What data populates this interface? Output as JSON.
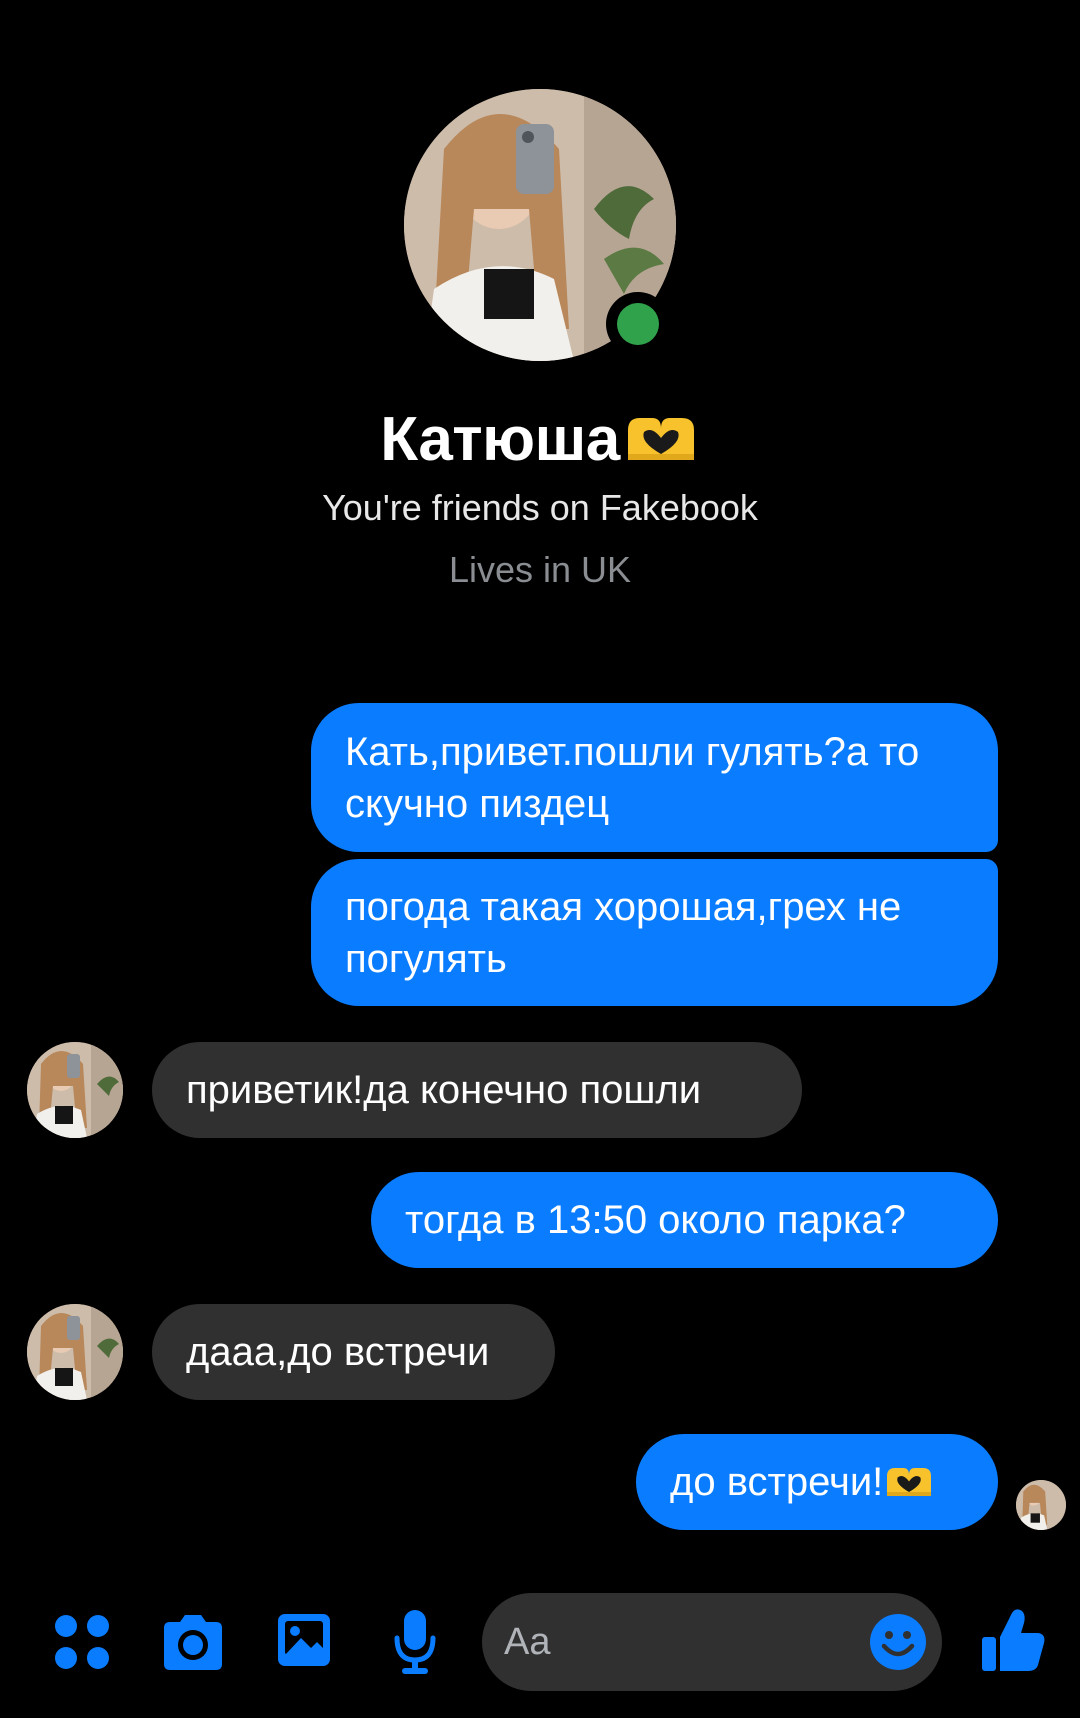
{
  "profile": {
    "name": "Катюша",
    "name_emoji_icon": "heart-hands-icon",
    "friends_text": "You're friends on Fakebook",
    "location_text": "Lives in UK",
    "online": true
  },
  "messages": [
    {
      "from": "me",
      "text": "Кать,привет.пошли гулять?а то скучно пиздец"
    },
    {
      "from": "me",
      "text": "погода такая хорошая,грех не погулять"
    },
    {
      "from": "them",
      "text": "приветик!да конечно пошли"
    },
    {
      "from": "me",
      "text": "тогда в 13:50 около парка?"
    },
    {
      "from": "them",
      "text": "дааа,до встречи"
    },
    {
      "from": "me",
      "text": "до встречи!",
      "emoji_icon": "heart-hands-icon"
    }
  ],
  "composer": {
    "placeholder": "Aa",
    "icons": [
      "apps-icon",
      "camera-icon",
      "gallery-icon",
      "microphone-icon",
      "emoji-icon",
      "thumbs-up-icon"
    ]
  },
  "colors": {
    "background": "#000000",
    "outgoing_bubble": "#0a7cff",
    "incoming_bubble": "#303030",
    "accent": "#0a7cff",
    "online": "#31a24c"
  }
}
